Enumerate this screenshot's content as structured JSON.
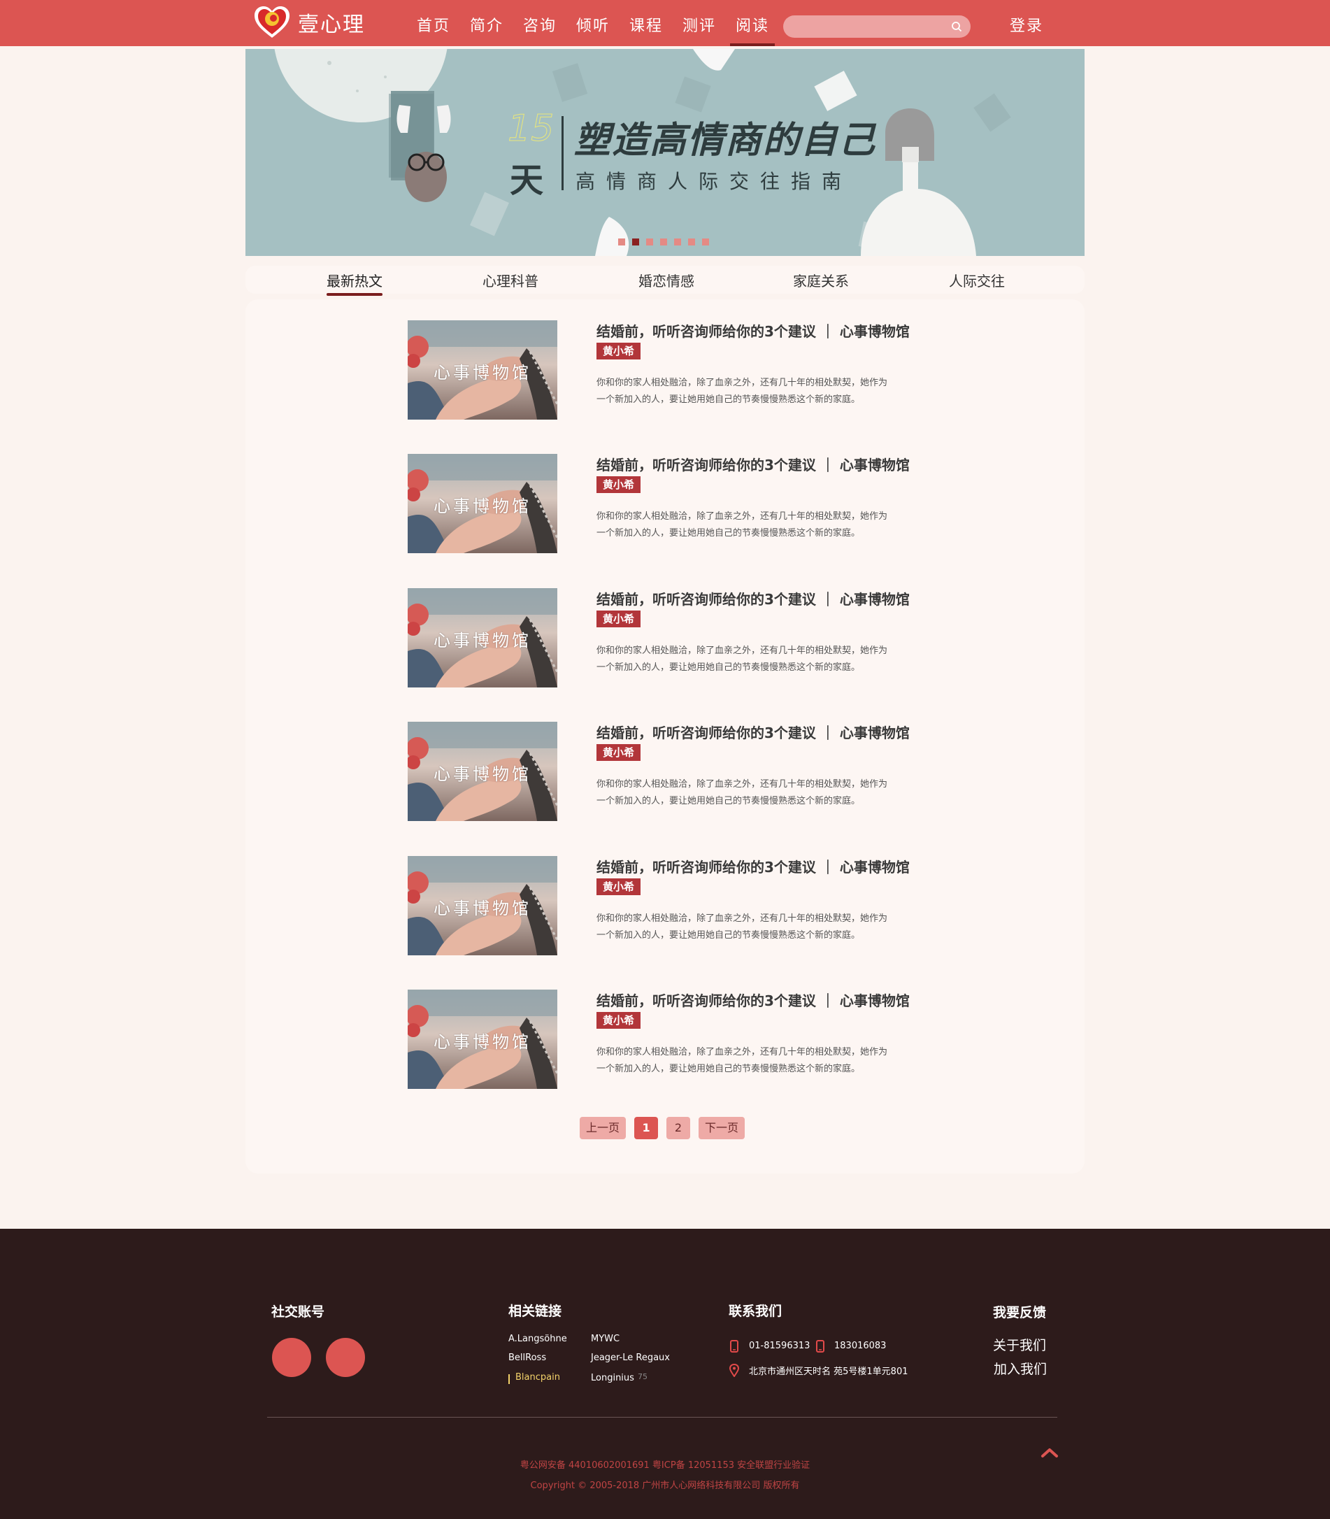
{
  "header": {
    "logo_text": "壹心理",
    "nav": [
      "首页",
      "简介",
      "咨询",
      "倾听",
      "课程",
      "测评",
      "阅读"
    ],
    "active_nav": "阅读",
    "search_placeholder": "",
    "login": "登录"
  },
  "banner": {
    "number": "15",
    "day": "天",
    "title": "塑造高情商的自己",
    "subtitle": "高情商人际交往指南",
    "slide_count": 7,
    "active_slide": 2
  },
  "tabs": {
    "items": [
      "最新热文",
      "心理科普",
      "婚恋情感",
      "家庭关系",
      "人际交往"
    ],
    "active": "最新热文"
  },
  "articles": [
    {
      "title": "结婚前，听听咨询师给你的3个建议 ｜ 心事博物馆",
      "author": "黄小希",
      "thumb_caption": "心事博物馆",
      "desc_line1": "你和你的家人相处融洽，除了血亲之外，还有几十年的相处默契，她作为",
      "desc_line2": "一个新加入的人，要让她用她自己的节奏慢慢熟悉这个新的家庭。"
    },
    {
      "title": "结婚前，听听咨询师给你的3个建议 ｜ 心事博物馆",
      "author": "黄小希",
      "thumb_caption": "心事博物馆",
      "desc_line1": "你和你的家人相处融洽，除了血亲之外，还有几十年的相处默契，她作为",
      "desc_line2": "一个新加入的人，要让她用她自己的节奏慢慢熟悉这个新的家庭。"
    },
    {
      "title": "结婚前，听听咨询师给你的3个建议 ｜ 心事博物馆",
      "author": "黄小希",
      "thumb_caption": "心事博物馆",
      "desc_line1": "你和你的家人相处融洽，除了血亲之外，还有几十年的相处默契，她作为",
      "desc_line2": "一个新加入的人，要让她用她自己的节奏慢慢熟悉这个新的家庭。"
    },
    {
      "title": "结婚前，听听咨询师给你的3个建议 ｜ 心事博物馆",
      "author": "黄小希",
      "thumb_caption": "心事博物馆",
      "desc_line1": "你和你的家人相处融洽，除了血亲之外，还有几十年的相处默契，她作为",
      "desc_line2": "一个新加入的人，要让她用她自己的节奏慢慢熟悉这个新的家庭。"
    },
    {
      "title": "结婚前，听听咨询师给你的3个建议 ｜ 心事博物馆",
      "author": "黄小希",
      "thumb_caption": "心事博物馆",
      "desc_line1": "你和你的家人相处融洽，除了血亲之外，还有几十年的相处默契，她作为",
      "desc_line2": "一个新加入的人，要让她用她自己的节奏慢慢熟悉这个新的家庭。"
    },
    {
      "title": "结婚前，听听咨询师给你的3个建议 ｜ 心事博物馆",
      "author": "黄小希",
      "thumb_caption": "心事博物馆",
      "desc_line1": "你和你的家人相处融洽，除了血亲之外，还有几十年的相处默契，她作为",
      "desc_line2": "一个新加入的人，要让她用她自己的节奏慢慢熟悉这个新的家庭。"
    }
  ],
  "pagination": {
    "prev": "上一页",
    "pages": [
      "1",
      "2"
    ],
    "current": "1",
    "next": "下一页"
  },
  "footer": {
    "social_heading": "社交账号",
    "links_heading": "相关链接",
    "links": [
      {
        "label": "A.Langsöhne"
      },
      {
        "label": "MYWC"
      },
      {
        "label": "BellRoss"
      },
      {
        "label": "Jeager-Le Regaux"
      },
      {
        "label": "Blancpain"
      },
      {
        "label": "Longinius"
      }
    ],
    "links_extra": "75",
    "contact_heading": "联系我们",
    "phone1": "01-81596313",
    "phone2": "183016083",
    "address": "北京市通州区天时名  苑5号楼1单元801",
    "feedback_heading": "我要反馈",
    "about": "关于我们",
    "join": "加入我们",
    "icp": "粤公网安备 44010602001691  粤ICP备 12051153  安全联盟行业验证",
    "copyright": "Copyright © 2005-2018 广州市人心网络科技有限公司 版权所有"
  },
  "colors": {
    "brand_red": "#dc5552",
    "dark_red": "#7a1d1d",
    "tag_red": "#b2363a",
    "footer_bg": "#2d1b1b",
    "page_bg": "#fbf3ef",
    "banner_bg": "#a5c0c2"
  }
}
